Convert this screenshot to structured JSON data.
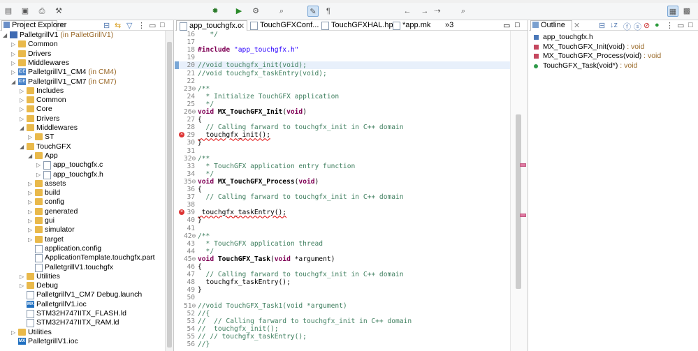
{
  "toolbar": {
    "icons": [
      "new-icon",
      "save-icon",
      "print-icon",
      "build-icon",
      "debug-icon",
      "run-icon",
      "external-tools-icon",
      "search-icon",
      "toggle-mark-icon",
      "annotation-icon",
      "back-icon",
      "forward-icon",
      "pin-icon",
      "quick-access-icon",
      "perspective-icon"
    ]
  },
  "explorer": {
    "title": "Project Explorer",
    "tree": [
      {
        "label": "PalletgrillV1",
        "suffix": " (in PalletGrillV1)",
        "indent": 0,
        "icon": "project",
        "twisty": "open"
      },
      {
        "label": "Common",
        "indent": 1,
        "icon": "folder",
        "twisty": "closed"
      },
      {
        "label": "Drivers",
        "indent": 1,
        "icon": "folder",
        "twisty": "closed"
      },
      {
        "label": "Middlewares",
        "indent": 1,
        "icon": "folder",
        "twisty": "closed"
      },
      {
        "label": "PalletgrillV1_CM4",
        "suffix": " (in CM4)",
        "indent": 1,
        "icon": "ide",
        "twisty": "closed"
      },
      {
        "label": "PalletgrillV1_CM7",
        "suffix": " (in CM7)",
        "indent": 1,
        "icon": "ide",
        "twisty": "open"
      },
      {
        "label": "Includes",
        "indent": 2,
        "icon": "folder",
        "twisty": "closed"
      },
      {
        "label": "Common",
        "indent": 2,
        "icon": "folder",
        "twisty": "closed"
      },
      {
        "label": "Core",
        "indent": 2,
        "icon": "folder",
        "twisty": "closed"
      },
      {
        "label": "Drivers",
        "indent": 2,
        "icon": "folder",
        "twisty": "closed"
      },
      {
        "label": "Middlewares",
        "indent": 2,
        "icon": "folder",
        "twisty": "open"
      },
      {
        "label": "ST",
        "indent": 3,
        "icon": "folder",
        "twisty": "closed"
      },
      {
        "label": "TouchGFX",
        "indent": 2,
        "icon": "folder",
        "twisty": "open"
      },
      {
        "label": "App",
        "indent": 3,
        "icon": "folder",
        "twisty": "open"
      },
      {
        "label": "app_touchgfx.c",
        "indent": 4,
        "icon": "file",
        "twisty": "closed"
      },
      {
        "label": "app_touchgfx.h",
        "indent": 4,
        "icon": "file",
        "twisty": "closed"
      },
      {
        "label": "assets",
        "indent": 3,
        "icon": "folder",
        "twisty": "closed"
      },
      {
        "label": "build",
        "indent": 3,
        "icon": "folder",
        "twisty": "closed"
      },
      {
        "label": "config",
        "indent": 3,
        "icon": "folder",
        "twisty": "closed"
      },
      {
        "label": "generated",
        "indent": 3,
        "icon": "folder",
        "twisty": "closed"
      },
      {
        "label": "gui",
        "indent": 3,
        "icon": "folder",
        "twisty": "closed"
      },
      {
        "label": "simulator",
        "indent": 3,
        "icon": "folder",
        "twisty": "closed"
      },
      {
        "label": "target",
        "indent": 3,
        "icon": "folder",
        "twisty": "closed"
      },
      {
        "label": "application.config",
        "indent": 3,
        "icon": "file",
        "twisty": "none"
      },
      {
        "label": "ApplicationTemplate.touchgfx.part",
        "indent": 3,
        "icon": "file",
        "twisty": "none"
      },
      {
        "label": "PalletgrillV1.touchgfx",
        "indent": 3,
        "icon": "file",
        "twisty": "none"
      },
      {
        "label": "Utilities",
        "indent": 2,
        "icon": "folder",
        "twisty": "closed"
      },
      {
        "label": "Debug",
        "indent": 2,
        "icon": "folder",
        "twisty": "closed"
      },
      {
        "label": "PalletgrillV1_CM7 Debug.launch",
        "indent": 2,
        "icon": "file",
        "twisty": "none"
      },
      {
        "label": "PalletgrillV1.ioc",
        "indent": 2,
        "icon": "mx",
        "twisty": "none"
      },
      {
        "label": "STM32H747IITX_FLASH.ld",
        "indent": 2,
        "icon": "file",
        "twisty": "none"
      },
      {
        "label": "STM32H747IITX_RAM.ld",
        "indent": 2,
        "icon": "file",
        "twisty": "none"
      },
      {
        "label": "Utilities",
        "indent": 1,
        "icon": "folder",
        "twisty": "closed"
      },
      {
        "label": "PalletgrillV1.ioc",
        "indent": 1,
        "icon": "mx",
        "twisty": "none"
      }
    ]
  },
  "editor": {
    "tabs": [
      {
        "label": "app_touchgfx.c",
        "close": "✕",
        "selected": true
      },
      {
        "label": "TouchGFXConf...",
        "selected": false
      },
      {
        "label": "TouchGFXHAL.hpp",
        "selected": false
      },
      {
        "label": "*app.mk",
        "selected": false
      },
      {
        "label": "»3",
        "selected": false
      }
    ],
    "lines": [
      {
        "n": "16",
        "t": "   */",
        "c": "cm"
      },
      {
        "n": "17",
        "t": "",
        "c": ""
      },
      {
        "n": "18",
        "t": "#include \"app_touchgfx.h\"",
        "c": "inc"
      },
      {
        "n": "19",
        "t": "",
        "c": ""
      },
      {
        "n": "20",
        "t": "//void touchgfx_init(void);",
        "c": "cm",
        "hl": true
      },
      {
        "n": "21",
        "t": "//void touchgfx_taskEntry(void);",
        "c": "cm"
      },
      {
        "n": "22",
        "t": "",
        "c": ""
      },
      {
        "n": "23⊖",
        "t": "/**",
        "c": "cm"
      },
      {
        "n": "24",
        "t": "  * Initialize TouchGFX application",
        "c": "cm"
      },
      {
        "n": "25",
        "t": "  */",
        "c": "cm"
      },
      {
        "n": "26⊖",
        "t": "void MX_TouchGFX_Init(void)",
        "c": "fn"
      },
      {
        "n": "27",
        "t": "{",
        "c": ""
      },
      {
        "n": "28",
        "t": "  // Calling farward to touchgfx_init in C++ domain",
        "c": "cm"
      },
      {
        "n": "29",
        "t": "  touchgfx_init();",
        "c": "sq",
        "err": true
      },
      {
        "n": "30",
        "t": "}",
        "c": ""
      },
      {
        "n": "31",
        "t": "",
        "c": ""
      },
      {
        "n": "32⊖",
        "t": "/**",
        "c": "cm"
      },
      {
        "n": "33",
        "t": "  * TouchGFX application entry function",
        "c": "cm"
      },
      {
        "n": "34",
        "t": "  */",
        "c": "cm"
      },
      {
        "n": "35⊖",
        "t": "void MX_TouchGFX_Process(void)",
        "c": "fn"
      },
      {
        "n": "36",
        "t": "{",
        "c": ""
      },
      {
        "n": "37",
        "t": "  // Calling farward to touchgfx_init in C++ domain",
        "c": "cm"
      },
      {
        "n": "38",
        "t": "",
        "c": ""
      },
      {
        "n": "39",
        "t": " touchgfx_taskEntry();",
        "c": "sq",
        "err": true
      },
      {
        "n": "40",
        "t": "}",
        "c": ""
      },
      {
        "n": "41",
        "t": "",
        "c": ""
      },
      {
        "n": "42⊖",
        "t": "/**",
        "c": "cm"
      },
      {
        "n": "43",
        "t": "  * TouchGFX application thread",
        "c": "cm"
      },
      {
        "n": "44",
        "t": "  */",
        "c": "cm"
      },
      {
        "n": "45⊖",
        "t": "void TouchGFX_Task(void *argument)",
        "c": "fn"
      },
      {
        "n": "46",
        "t": "{",
        "c": ""
      },
      {
        "n": "47",
        "t": "  // Calling farward to touchgfx_init in C++ domain",
        "c": "cm"
      },
      {
        "n": "48",
        "t": "  touchgfx_taskEntry();",
        "c": ""
      },
      {
        "n": "49",
        "t": "}",
        "c": ""
      },
      {
        "n": "50",
        "t": "",
        "c": ""
      },
      {
        "n": "51⊖",
        "t": "//void TouchGFX_Task1(void *argument)",
        "c": "cm"
      },
      {
        "n": "52",
        "t": "//{",
        "c": "cm"
      },
      {
        "n": "53",
        "t": "//  // Calling farward to touchgfx_init in C++ domain",
        "c": "cm"
      },
      {
        "n": "54",
        "t": "//  touchgfx_init();",
        "c": "cm"
      },
      {
        "n": "55",
        "t": "// // touchgfx_taskEntry();",
        "c": "cm"
      },
      {
        "n": "56",
        "t": "//}",
        "c": "cm"
      }
    ]
  },
  "outline": {
    "title": "Outline",
    "items": [
      {
        "name": "app_touchgfx.h",
        "ret": "",
        "icon": "include"
      },
      {
        "name": "MX_TouchGFX_Init(void)",
        "ret": " : void",
        "icon": "func"
      },
      {
        "name": "MX_TouchGFX_Process(void)",
        "ret": " : void",
        "icon": "func"
      },
      {
        "name": "TouchGFX_Task(void*)",
        "ret": " : void",
        "icon": "dot"
      }
    ]
  }
}
